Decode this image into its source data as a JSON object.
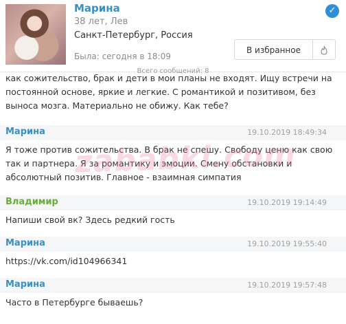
{
  "profile": {
    "name": "Марина",
    "age": "38 лет, Лев",
    "city": "Санкт-Петербург, Россия",
    "last_seen": "Была: сегодня в 18:09",
    "favorite_label": "В избранное",
    "total_messages": "Всего сообщений: 8"
  },
  "messages": [
    {
      "text": "как сожительство, брак и дети в мои планы не входят. Ищу встречи на постоянной основе, яркие и легкие. С романтикой и позитивом, без выноса мозга. Материально не обижу. Как тебе?"
    },
    {
      "author": "Марина",
      "time": "19.10.2019 18:49:34",
      "text": "Я тоже против сожительства. В брак не спешу. Свободу ценю как свою так и партнера. Я за романтику и эмоции. Смену обстановки и абсолютный позитив. Главное - взаимная симпатия"
    },
    {
      "author": "Владимир",
      "time": "19.10.2019 19:14:49",
      "text": "Напиши свой вк? Здесь редкий гость"
    },
    {
      "author": "Марина",
      "time": "19.10.2019 19:55:40",
      "text": "https://vk.com/id104966341"
    },
    {
      "author": "Марина",
      "time": "19.10.2019 19:57:48",
      "text": "Часто в Петербурге бываешь?"
    }
  ],
  "watermark": "zababki.com",
  "colors": {
    "female_author": "#3a8fc2",
    "male_author": "#6aac3a",
    "verified_badge": "#2f8fd6"
  },
  "icons": {
    "verified": "check-circle-icon",
    "fire": "fire-icon"
  }
}
